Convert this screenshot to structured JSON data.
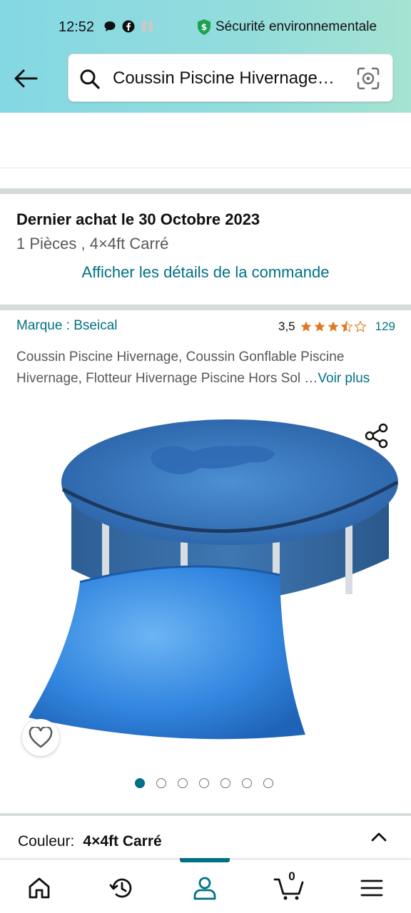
{
  "status_bar": {
    "time": "12:52",
    "security_text": "Sécurité environnementale"
  },
  "search": {
    "query": "Coussin Piscine Hivernage…"
  },
  "purchase": {
    "title": "Dernier achat le 30 Octobre 2023",
    "subtitle": "1 Pièces , 4×4ft Carré",
    "order_link": "Afficher les détails de la commande"
  },
  "product": {
    "brand": "Marque : Bseical",
    "rating_value": "3,5",
    "rating_stars": 3.5,
    "rating_count": "129",
    "description": "Coussin Piscine Hivernage, Coussin Gonflable Piscine Hivernage, Flotteur Hivernage Piscine Hors Sol …",
    "more_link": "Voir plus",
    "image_count": 7,
    "image_index": 1
  },
  "variant": {
    "label": "Couleur:",
    "value": "4×4ft Carré"
  },
  "nav": {
    "cart_count": "0",
    "items": [
      "home-icon",
      "history-icon",
      "account-icon",
      "cart-icon",
      "menu-icon"
    ]
  },
  "colors": {
    "accent": "#007185",
    "star": "#de7921",
    "header_start": "#84d8e3",
    "header_end": "#a5e3d2"
  }
}
